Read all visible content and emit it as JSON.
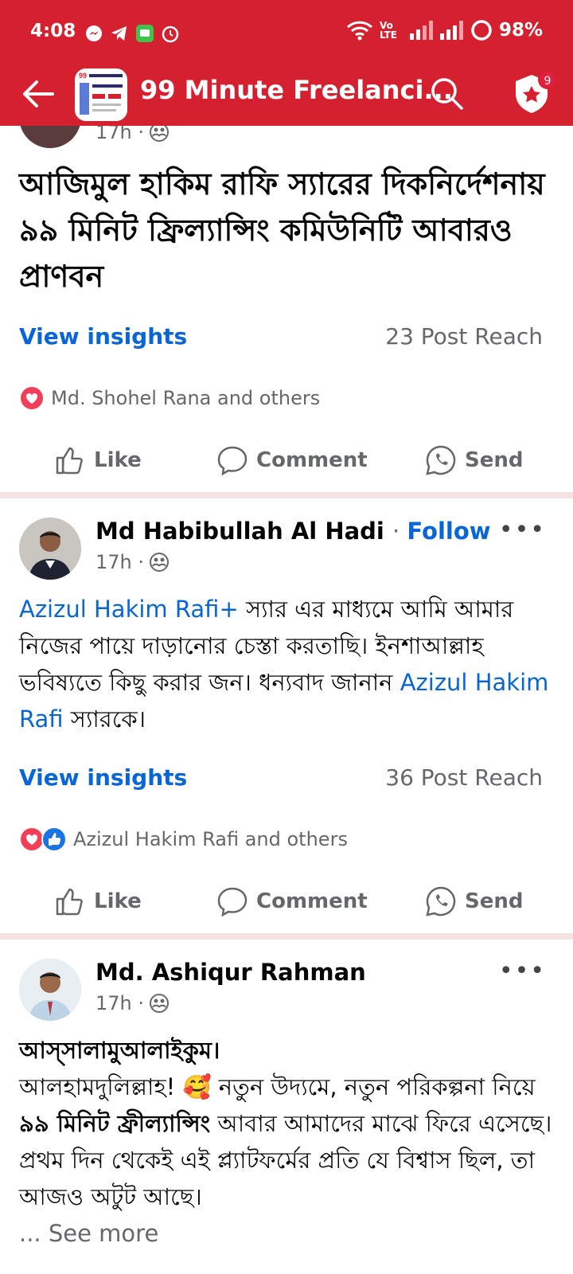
{
  "status_bar": {
    "time": "4:08",
    "network": "Vo LTE",
    "battery": "98%"
  },
  "header": {
    "title": "99 Minute Freelanci...",
    "badge_count": "9"
  },
  "post1": {
    "time": "17h · ",
    "text": "আজিমুল হাকিম রাফি স্যারের দিকনির্দেশনায় ৯৯ মিনিট ফ্রিল্যান্সিং কমিউনিটি আবারও প্রাণবন",
    "insights": "View insights",
    "reach": "23 Post Reach",
    "reactions": "Md. Shohel Rana and others"
  },
  "post2": {
    "author": "Md Habibullah Al Hadi",
    "follow": "Follow",
    "time": "17h · ",
    "mention1": "Azizul Hakim Rafi+",
    "text1": "  স্যার এর মাধ্যমে আমি আমার নিজের পায়ে দাড়ানোর চেস্তা করতাছি। ইনশাআল্লাহ ভবিষ্যতে কিছু করার জন। ধন্যবাদ জানান ",
    "mention2": "Azizul Hakim Rafi",
    "text2": "  স্যারকে।",
    "insights": "View insights",
    "reach": "36 Post Reach",
    "reactions": "Azizul Hakim Rafi and others"
  },
  "post3": {
    "author": "Md. Ashiqur Rahman",
    "time": "17h · ",
    "greeting": "আস্সালামুআলাইকুম।",
    "text_a": "আলহামদুলিল্লাহ! 🥰 নতুন উদ্যমে, নতুন পরিকল্পনা নিয়ে ",
    "text_bold": "৯৯ মিনিট ফ্রীল্যান্সিং",
    "text_b": " আবার আমাদের মাঝে ফিরে এসেছে। প্রথম দিন থেকেই এই প্ল্যাটফর্মের প্রতি যে বিশ্বাস ছিল, তা আজও অটুট আছে।",
    "see_more": "... See more"
  },
  "actions": {
    "like": "Like",
    "comment": "Comment",
    "send": "Send"
  },
  "colors": {
    "header_bg": "#d4202f",
    "link": "#0866d6",
    "muted": "#65676b",
    "divider": "#f6e3e5"
  }
}
